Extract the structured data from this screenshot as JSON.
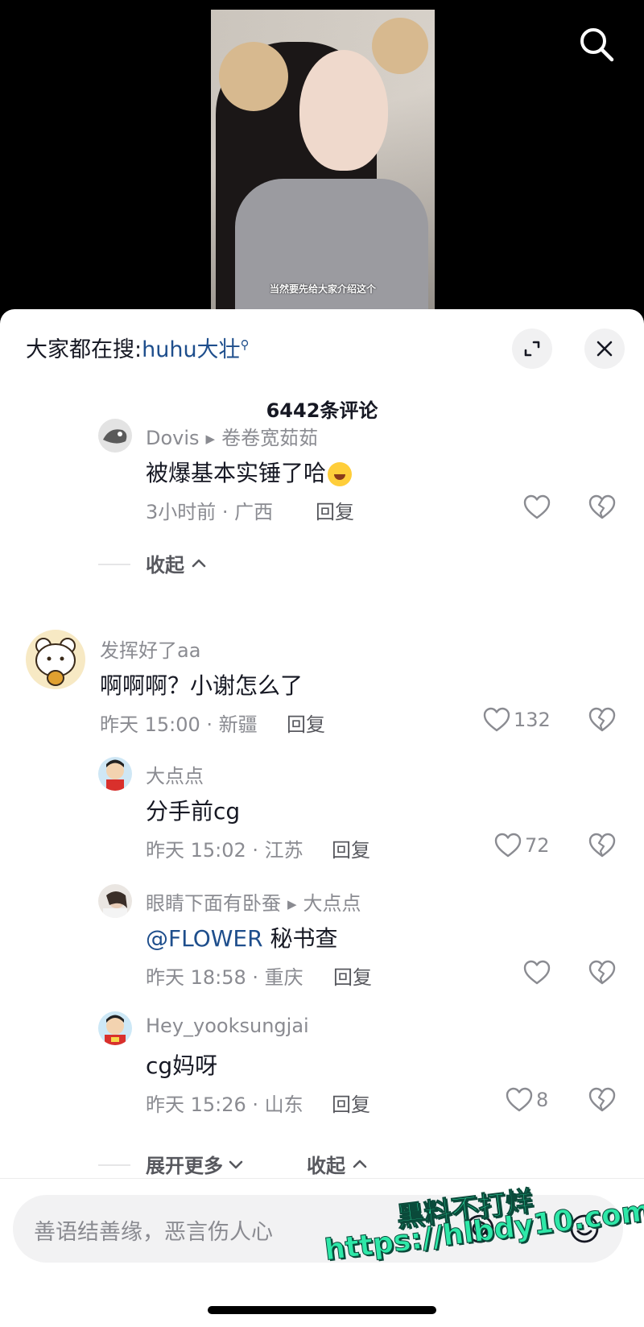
{
  "video": {
    "subtitle": "当然要先给大家介绍这个"
  },
  "panel": {
    "everyone_search_prefix": "大家都在搜:",
    "everyone_search_keyword": "huhu大壮",
    "comment_count": "6442条评论"
  },
  "comments": [
    {
      "user": "Dovis",
      "reply_to": "卷卷宽茹茹",
      "text": "被爆基本实锤了哈",
      "time_location": "3小时前 · 广西",
      "reply_label": "回复",
      "likes": ""
    },
    {
      "fold_label": "收起"
    },
    {
      "user": "发挥好了aa",
      "text": "啊啊啊？小谢怎么了",
      "time_location": "昨天 15:00 · 新疆",
      "reply_label": "回复",
      "likes": "132"
    },
    {
      "user": "大点点",
      "text": "分手前cg",
      "time_location": "昨天 15:02 · 江苏",
      "reply_label": "回复",
      "likes": "72"
    },
    {
      "user": "眼睛下面有卧蚕",
      "reply_to": "大点点",
      "mention": "@FLOWER",
      "text": "秘书查",
      "time_location": "昨天 18:58 · 重庆",
      "reply_label": "回复",
      "likes": ""
    },
    {
      "user": "Hey_yooksungjai",
      "text": "cg妈呀",
      "time_location": "昨天 15:26 · 山东",
      "reply_label": "回复",
      "likes": "8"
    }
  ],
  "thread_controls": {
    "expand_more": "展开更多",
    "collapse": "收起"
  },
  "input": {
    "placeholder": "善语结善缘，恶言伤人心"
  },
  "watermark": {
    "line1": "黑料不打烊",
    "line2": "https://hlbdy10.com"
  },
  "colors": {
    "link": "#1e4e8c",
    "meta_gray": "#8a8b91",
    "watermark": "#2ee8a8"
  }
}
